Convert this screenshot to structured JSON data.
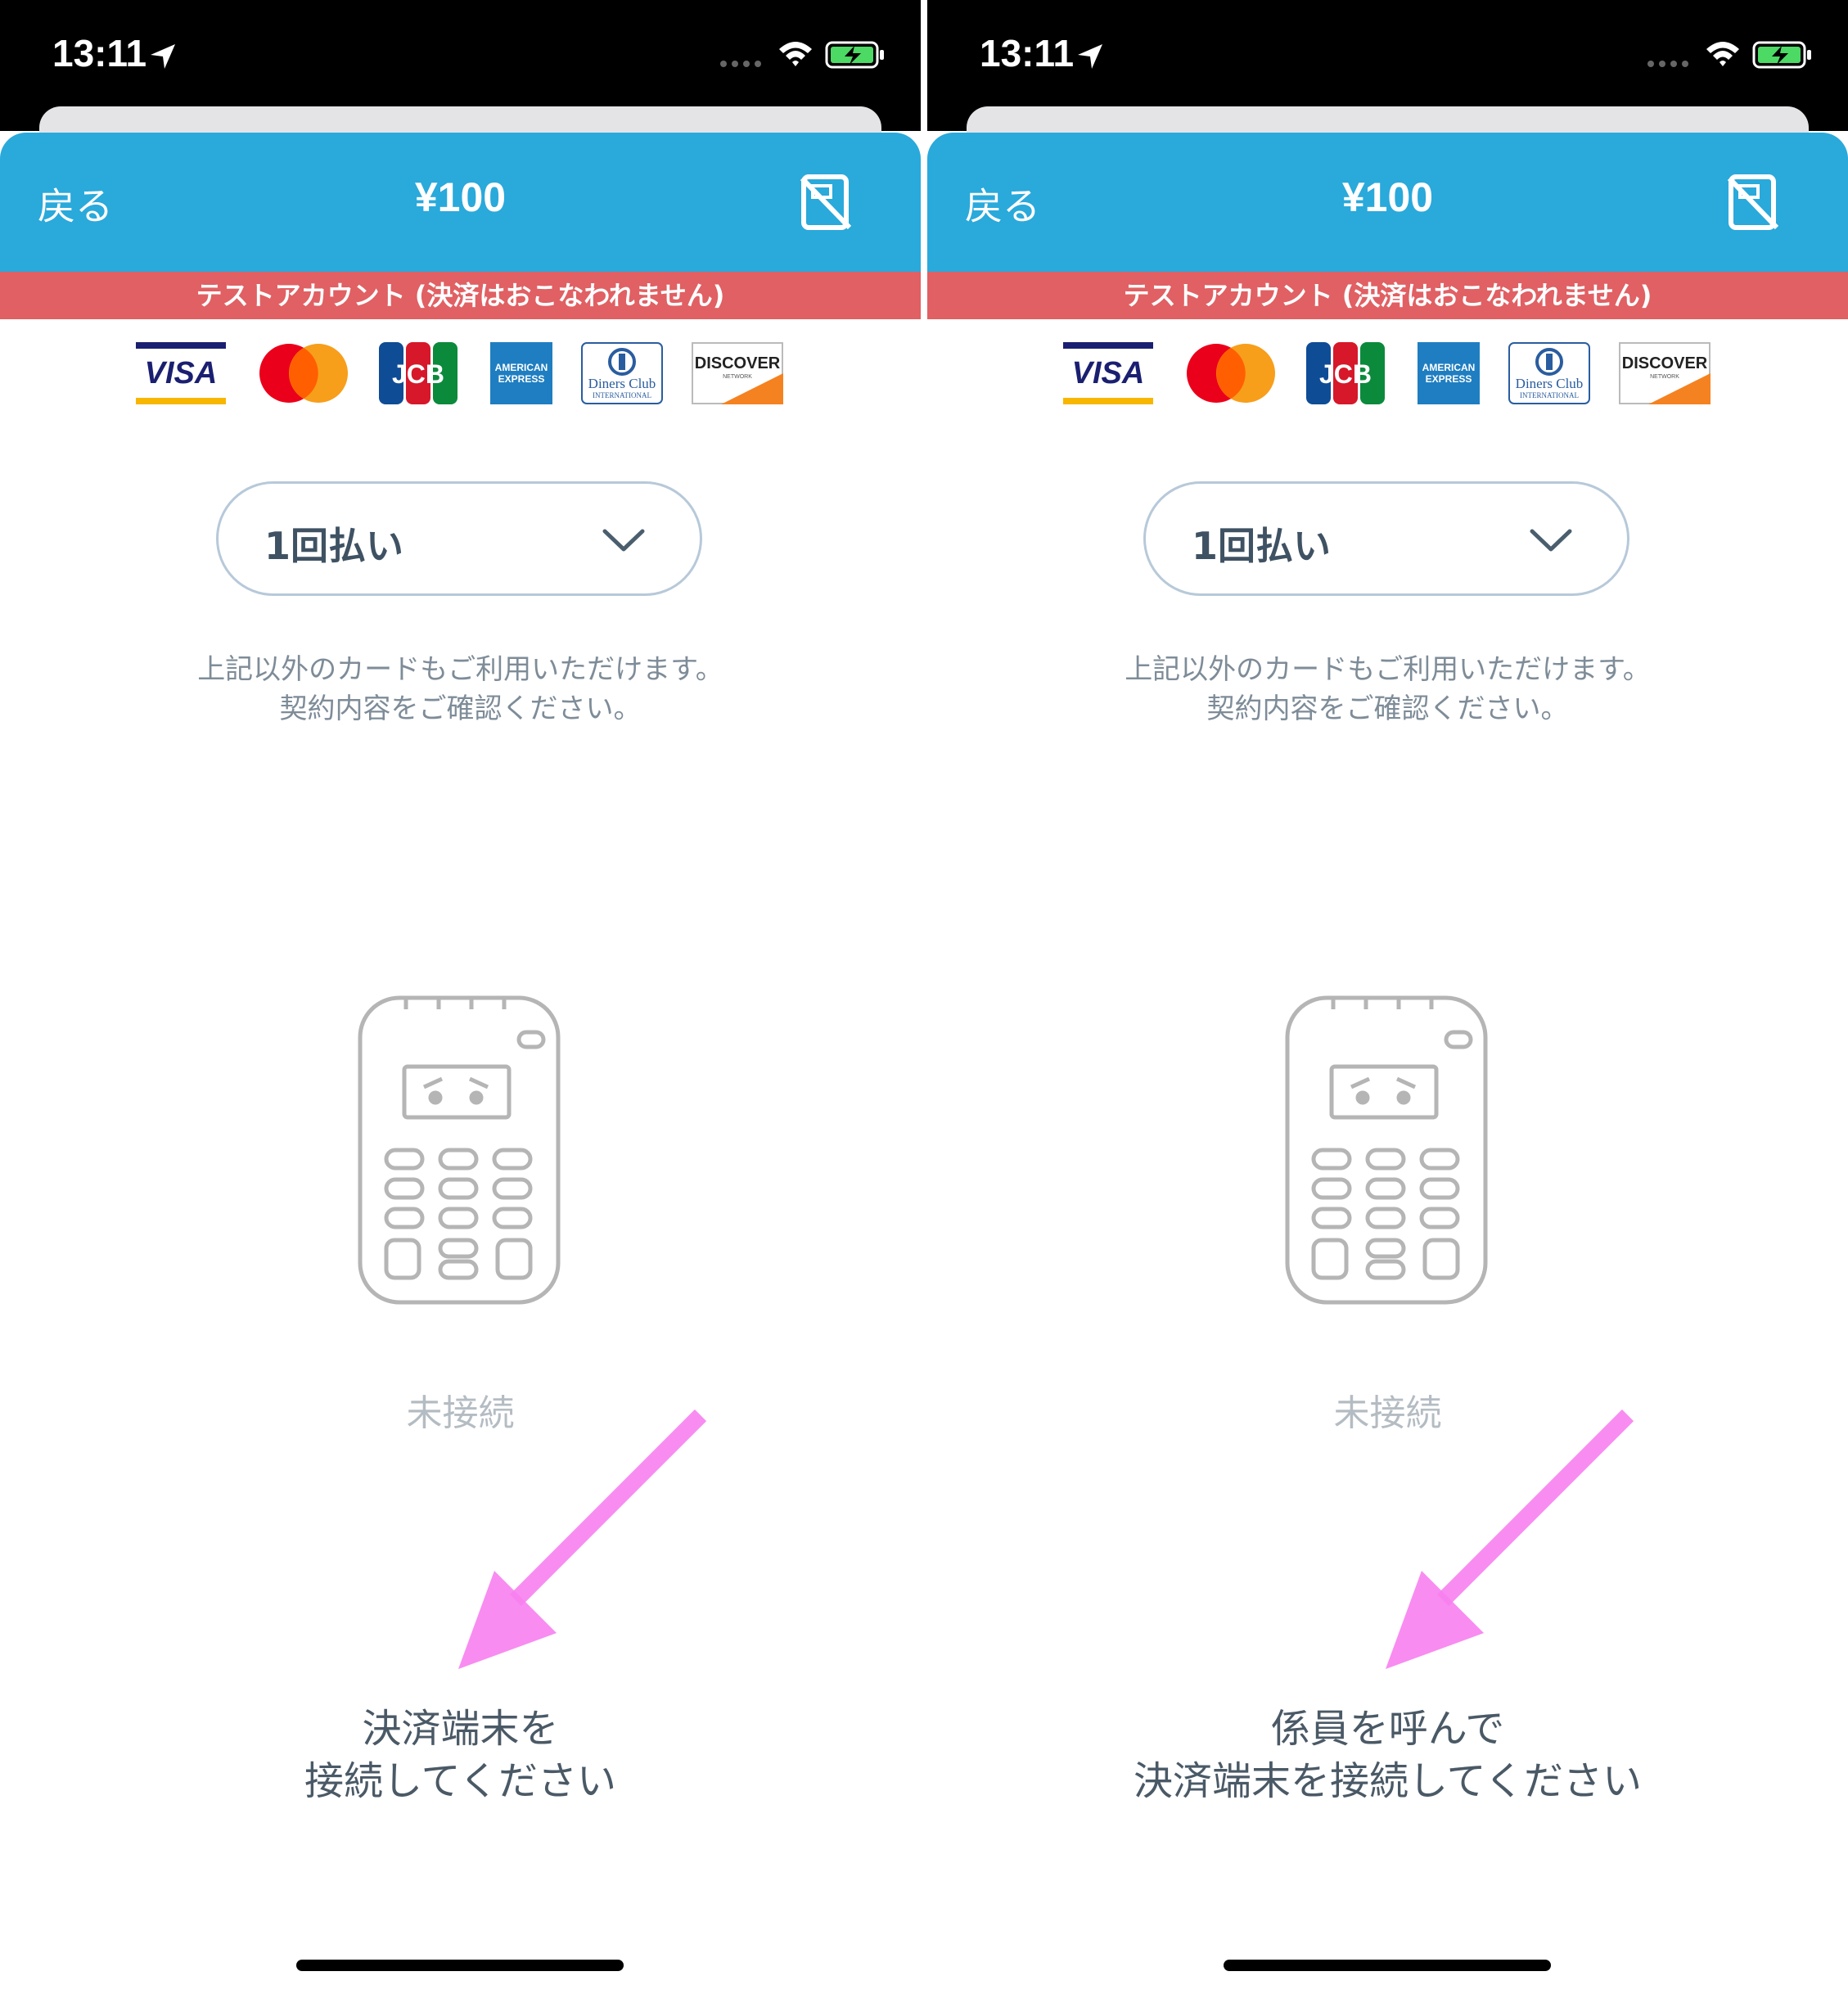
{
  "screens": [
    {
      "status_bar": {
        "time": "13:11"
      },
      "header": {
        "back_label": "戻る",
        "amount": "¥100"
      },
      "test_banner": "テストアカウント (決済はおこなわれません)",
      "brands": {
        "visa": "VISA",
        "jcb": "JCB",
        "amex_line1": "AMERICAN",
        "amex_line2": "EXPRESS",
        "diners_line1": "Diners Club",
        "diners_line2": "INTERNATIONAL",
        "discover_line1": "DISCOVER",
        "discover_line2": "NETWORK"
      },
      "installment": {
        "selected": "1回払い"
      },
      "note": [
        "上記以外のカードもご利用いただけます。",
        "契約内容をご確認ください。"
      ],
      "terminal_status": "未接続",
      "instruction": [
        "決済端末を",
        "接続してください"
      ]
    },
    {
      "status_bar": {
        "time": "13:11"
      },
      "header": {
        "back_label": "戻る",
        "amount": "¥100"
      },
      "test_banner": "テストアカウント (決済はおこなわれません)",
      "brands": {
        "visa": "VISA",
        "jcb": "JCB",
        "amex_line1": "AMERICAN",
        "amex_line2": "EXPRESS",
        "diners_line1": "Diners Club",
        "diners_line2": "INTERNATIONAL",
        "discover_line1": "DISCOVER",
        "discover_line2": "NETWORK"
      },
      "installment": {
        "selected": "1回払い"
      },
      "note": [
        "上記以外のカードもご利用いただけます。",
        "契約内容をご確認ください。"
      ],
      "terminal_status": "未接続",
      "instruction": [
        "係員を呼んで",
        "決済端末を接続してください"
      ]
    }
  ],
  "colors": {
    "header_blue": "#2aa9db",
    "test_banner_red": "#e06063",
    "annotation_arrow": "#f77ff0",
    "terminal_icon_gray": "#b5b5b5"
  },
  "icons": [
    "location-arrow-icon",
    "signal-icon",
    "wifi-icon",
    "battery-charging-icon",
    "no-card-icon",
    "chevron-down-icon",
    "card-terminal-icon"
  ]
}
